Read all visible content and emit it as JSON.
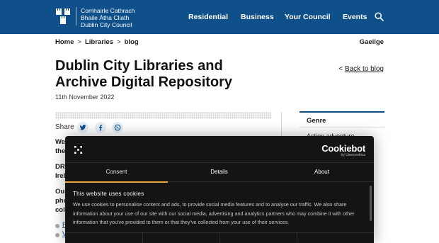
{
  "header": {
    "logo": {
      "line1": "Comhairle Cathrach",
      "line2": "Bhaile Átha Cliath",
      "line3": "Dublin City Council"
    },
    "nav": [
      "Residential",
      "Business",
      "Your Council",
      "Events"
    ]
  },
  "breadcrumb": {
    "items": [
      "Home",
      "Libraries",
      "blog"
    ],
    "separator": ">"
  },
  "language_link": "Gaeilge",
  "article": {
    "title": "Dublin City Libraries and Archive Digital Repository",
    "back_link": {
      "chevron": "<",
      "label": "Back to blog"
    },
    "date": "11th November 2022",
    "share_label": "Share",
    "share_icons": [
      "twitter-icon",
      "facebook-icon",
      "whatsapp-icon"
    ],
    "frag1": "We",
    "frag2": "the",
    "frag3": "DRI",
    "frag4": "Irela",
    "frag5": "Our",
    "frag6": "pho",
    "frag7": "colle",
    "link1": "F",
    "link2": "V"
  },
  "sidebar": {
    "genre_title": "Genre",
    "genre_item": "Action adventure"
  },
  "cookie": {
    "brand": "Cookiebot",
    "brand_by": "by Usercentrics",
    "tabs": [
      "Consent",
      "Details",
      "About"
    ],
    "heading": "This website uses cookies",
    "body": "We use cookies to personalise content and ads, to provide social media features and to analyse our traffic. We also share information about your use of our site with our social media, advertising and analytics partners who may combine it with other information that you've provided to them or that they've collected from your use of their services."
  },
  "colors": {
    "header_bg": "#0f4f8a",
    "cookie_bg": "#141414",
    "active_tab_accent": "#e8a93a",
    "link": "#0f4f8a"
  }
}
